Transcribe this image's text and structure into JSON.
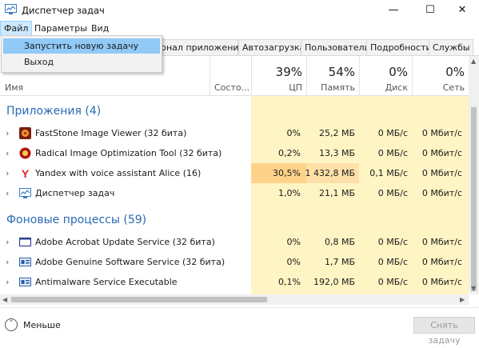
{
  "window": {
    "title": "Диспетчер задач",
    "minimize": "—",
    "maximize": "☐",
    "close": "✕"
  },
  "menu": {
    "file": "Файл",
    "params": "Параметры",
    "view": "Вид"
  },
  "file_menu": {
    "items": [
      "Запустить новую задачу",
      "Выход"
    ]
  },
  "tabs": [
    "рнал приложений",
    "Автозагрузка",
    "Пользователи",
    "Подробности",
    "Службы"
  ],
  "columns": {
    "name": "Имя",
    "status": "Состо...",
    "cpu": {
      "pct": "39%",
      "label": "ЦП"
    },
    "mem": {
      "pct": "54%",
      "label": "Память"
    },
    "disk": {
      "pct": "0%",
      "label": "Диск"
    },
    "net": {
      "pct": "0%",
      "label": "Сеть"
    }
  },
  "groups": {
    "apps": "Приложения (4)",
    "background": "Фоновые процессы (59)"
  },
  "apps": [
    {
      "name": "FastStone Image Viewer (32 бита)",
      "cpu": "0%",
      "mem": "25,2 МБ",
      "disk": "0 МБ/с",
      "net": "0 Мбит/с"
    },
    {
      "name": "Radical Image Optimization Tool (32 бита)",
      "cpu": "0,2%",
      "mem": "13,3 МБ",
      "disk": "0 МБ/с",
      "net": "0 Мбит/с"
    },
    {
      "name": "Yandex with voice assistant Alice (16)",
      "cpu": "30,5%",
      "mem": "1 432,8 МБ",
      "disk": "0,1 МБ/с",
      "net": "0 Мбит/с"
    },
    {
      "name": "Диспетчер задач",
      "cpu": "1,0%",
      "mem": "21,1 МБ",
      "disk": "0 МБ/с",
      "net": "0 Мбит/с"
    }
  ],
  "background": [
    {
      "name": "Adobe Acrobat Update Service (32 бита)",
      "cpu": "0%",
      "mem": "0,8 МБ",
      "disk": "0 МБ/с",
      "net": "0 Мбит/с"
    },
    {
      "name": "Adobe Genuine Software Service (32 бита)",
      "cpu": "0%",
      "mem": "1,7 МБ",
      "disk": "0 МБ/с",
      "net": "0 Мбит/с"
    },
    {
      "name": "Antimalware Service Executable",
      "cpu": "0,1%",
      "mem": "192,0 МБ",
      "disk": "0 МБ/с",
      "net": "0 Мбит/с"
    }
  ],
  "footer": {
    "less": "Меньше",
    "end_task": "Снять задачу"
  },
  "colors": {
    "shade": "#fff4c4",
    "highlight": "#ffd28a",
    "group": "#2a6ab4",
    "menu_hover": "#91c9f7"
  }
}
